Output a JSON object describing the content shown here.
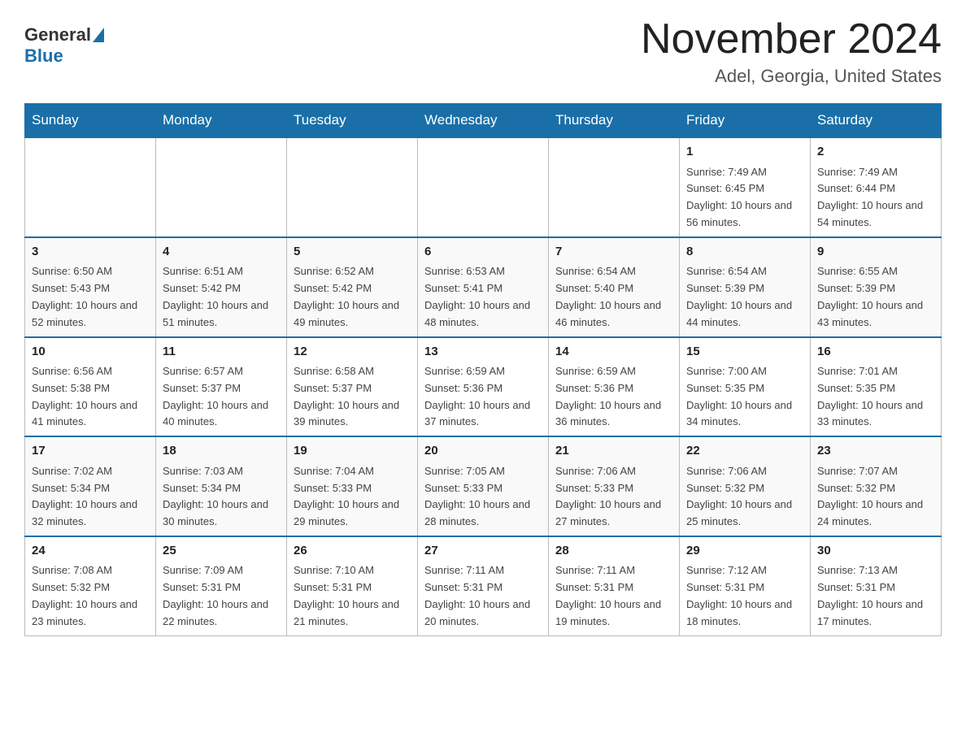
{
  "header": {
    "logo_general": "General",
    "logo_blue": "Blue",
    "month_title": "November 2024",
    "location": "Adel, Georgia, United States"
  },
  "days_of_week": [
    "Sunday",
    "Monday",
    "Tuesday",
    "Wednesday",
    "Thursday",
    "Friday",
    "Saturday"
  ],
  "weeks": [
    {
      "days": [
        {
          "number": "",
          "info": ""
        },
        {
          "number": "",
          "info": ""
        },
        {
          "number": "",
          "info": ""
        },
        {
          "number": "",
          "info": ""
        },
        {
          "number": "",
          "info": ""
        },
        {
          "number": "1",
          "info": "Sunrise: 7:49 AM\nSunset: 6:45 PM\nDaylight: 10 hours and 56 minutes."
        },
        {
          "number": "2",
          "info": "Sunrise: 7:49 AM\nSunset: 6:44 PM\nDaylight: 10 hours and 54 minutes."
        }
      ]
    },
    {
      "days": [
        {
          "number": "3",
          "info": "Sunrise: 6:50 AM\nSunset: 5:43 PM\nDaylight: 10 hours and 52 minutes."
        },
        {
          "number": "4",
          "info": "Sunrise: 6:51 AM\nSunset: 5:42 PM\nDaylight: 10 hours and 51 minutes."
        },
        {
          "number": "5",
          "info": "Sunrise: 6:52 AM\nSunset: 5:42 PM\nDaylight: 10 hours and 49 minutes."
        },
        {
          "number": "6",
          "info": "Sunrise: 6:53 AM\nSunset: 5:41 PM\nDaylight: 10 hours and 48 minutes."
        },
        {
          "number": "7",
          "info": "Sunrise: 6:54 AM\nSunset: 5:40 PM\nDaylight: 10 hours and 46 minutes."
        },
        {
          "number": "8",
          "info": "Sunrise: 6:54 AM\nSunset: 5:39 PM\nDaylight: 10 hours and 44 minutes."
        },
        {
          "number": "9",
          "info": "Sunrise: 6:55 AM\nSunset: 5:39 PM\nDaylight: 10 hours and 43 minutes."
        }
      ]
    },
    {
      "days": [
        {
          "number": "10",
          "info": "Sunrise: 6:56 AM\nSunset: 5:38 PM\nDaylight: 10 hours and 41 minutes."
        },
        {
          "number": "11",
          "info": "Sunrise: 6:57 AM\nSunset: 5:37 PM\nDaylight: 10 hours and 40 minutes."
        },
        {
          "number": "12",
          "info": "Sunrise: 6:58 AM\nSunset: 5:37 PM\nDaylight: 10 hours and 39 minutes."
        },
        {
          "number": "13",
          "info": "Sunrise: 6:59 AM\nSunset: 5:36 PM\nDaylight: 10 hours and 37 minutes."
        },
        {
          "number": "14",
          "info": "Sunrise: 6:59 AM\nSunset: 5:36 PM\nDaylight: 10 hours and 36 minutes."
        },
        {
          "number": "15",
          "info": "Sunrise: 7:00 AM\nSunset: 5:35 PM\nDaylight: 10 hours and 34 minutes."
        },
        {
          "number": "16",
          "info": "Sunrise: 7:01 AM\nSunset: 5:35 PM\nDaylight: 10 hours and 33 minutes."
        }
      ]
    },
    {
      "days": [
        {
          "number": "17",
          "info": "Sunrise: 7:02 AM\nSunset: 5:34 PM\nDaylight: 10 hours and 32 minutes."
        },
        {
          "number": "18",
          "info": "Sunrise: 7:03 AM\nSunset: 5:34 PM\nDaylight: 10 hours and 30 minutes."
        },
        {
          "number": "19",
          "info": "Sunrise: 7:04 AM\nSunset: 5:33 PM\nDaylight: 10 hours and 29 minutes."
        },
        {
          "number": "20",
          "info": "Sunrise: 7:05 AM\nSunset: 5:33 PM\nDaylight: 10 hours and 28 minutes."
        },
        {
          "number": "21",
          "info": "Sunrise: 7:06 AM\nSunset: 5:33 PM\nDaylight: 10 hours and 27 minutes."
        },
        {
          "number": "22",
          "info": "Sunrise: 7:06 AM\nSunset: 5:32 PM\nDaylight: 10 hours and 25 minutes."
        },
        {
          "number": "23",
          "info": "Sunrise: 7:07 AM\nSunset: 5:32 PM\nDaylight: 10 hours and 24 minutes."
        }
      ]
    },
    {
      "days": [
        {
          "number": "24",
          "info": "Sunrise: 7:08 AM\nSunset: 5:32 PM\nDaylight: 10 hours and 23 minutes."
        },
        {
          "number": "25",
          "info": "Sunrise: 7:09 AM\nSunset: 5:31 PM\nDaylight: 10 hours and 22 minutes."
        },
        {
          "number": "26",
          "info": "Sunrise: 7:10 AM\nSunset: 5:31 PM\nDaylight: 10 hours and 21 minutes."
        },
        {
          "number": "27",
          "info": "Sunrise: 7:11 AM\nSunset: 5:31 PM\nDaylight: 10 hours and 20 minutes."
        },
        {
          "number": "28",
          "info": "Sunrise: 7:11 AM\nSunset: 5:31 PM\nDaylight: 10 hours and 19 minutes."
        },
        {
          "number": "29",
          "info": "Sunrise: 7:12 AM\nSunset: 5:31 PM\nDaylight: 10 hours and 18 minutes."
        },
        {
          "number": "30",
          "info": "Sunrise: 7:13 AM\nSunset: 5:31 PM\nDaylight: 10 hours and 17 minutes."
        }
      ]
    }
  ]
}
